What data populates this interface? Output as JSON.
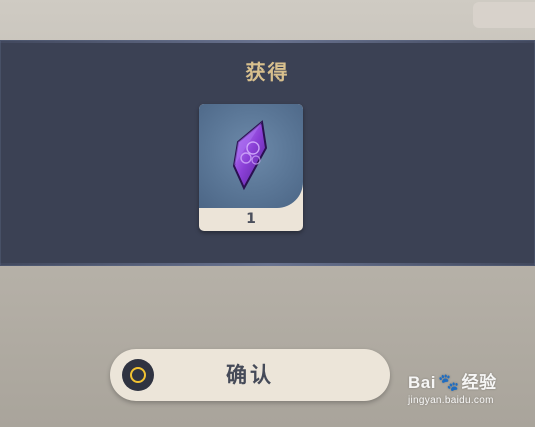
{
  "dialog": {
    "title": "获得"
  },
  "reward_item": {
    "icon": "purple-crystal-icon",
    "count": "1",
    "colors": {
      "gem": "#8a3fd6",
      "gem_highlight": "#c58cff",
      "background": "#5a7696"
    }
  },
  "confirm_button": {
    "label": "确认",
    "icon": "confirm-circle-icon",
    "icon_accent": "#f1c232"
  },
  "watermark": {
    "logo_text_left": "Bai",
    "logo_paw": "🐾",
    "logo_text_right": "经验",
    "url": "jingyan.baidu.com"
  }
}
